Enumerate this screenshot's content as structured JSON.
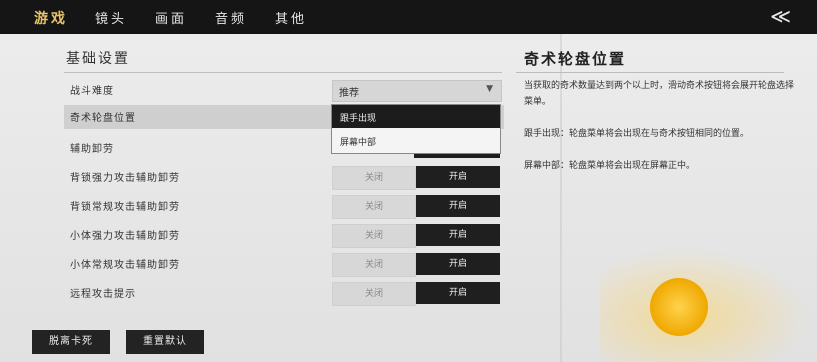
{
  "tabs": [
    {
      "label": "游戏",
      "active": true
    },
    {
      "label": "镜头",
      "active": false
    },
    {
      "label": "画面",
      "active": false
    },
    {
      "label": "音频",
      "active": false
    },
    {
      "label": "其他",
      "active": false
    }
  ],
  "back_glyph": "≪",
  "section": {
    "title": "基础设置"
  },
  "settings": {
    "combat_difficulty": {
      "label": "战斗难度",
      "value": "推荐"
    },
    "wheel_position": {
      "label": "奇术轮盘位置",
      "options": [
        "跟手出现",
        "屏幕中部"
      ],
      "selected": "跟手出现"
    },
    "assist_aim": {
      "label": "辅助卸劳"
    },
    "toggle_rows": [
      {
        "label": "背锁强力攻击辅助卸劳",
        "off": "关闭",
        "on": "开启"
      },
      {
        "label": "背锁常规攻击辅助卸劳",
        "off": "关闭",
        "on": "开启"
      },
      {
        "label": "小体强力攻击辅助卸劳",
        "off": "关闭",
        "on": "开启"
      },
      {
        "label": "小体常规攻击辅助卸劳",
        "off": "关闭",
        "on": "开启"
      },
      {
        "label": "远程攻击提示",
        "off": "关闭",
        "on": "开启"
      }
    ]
  },
  "detail": {
    "title": "奇术轮盘位置",
    "paragraphs": [
      "当获取的奇术数量达到两个以上时，滑动奇术按钮将会展开轮盘选择菜单。",
      "跟手出现：轮盘菜单将会出现在与奇术按钮相同的位置。",
      "屏幕中部：轮盘菜单将会出现在屏幕正中。"
    ]
  },
  "footer": {
    "left_button": "脱离卡死",
    "right_button": "重置默认"
  },
  "colors": {
    "accent": "#e8c26a",
    "topbar": "#151515",
    "toggle_on": "#1f1f1f"
  }
}
